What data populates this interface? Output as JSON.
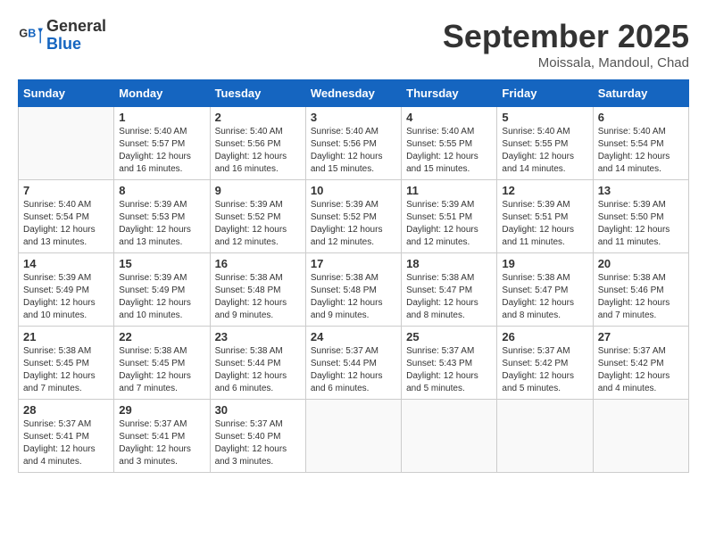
{
  "logo": {
    "line1": "General",
    "line2": "Blue"
  },
  "title": "September 2025",
  "subtitle": "Moissala, Mandoul, Chad",
  "days_of_week": [
    "Sunday",
    "Monday",
    "Tuesday",
    "Wednesday",
    "Thursday",
    "Friday",
    "Saturday"
  ],
  "weeks": [
    [
      {
        "day": "",
        "content": ""
      },
      {
        "day": "1",
        "content": "Sunrise: 5:40 AM\nSunset: 5:57 PM\nDaylight: 12 hours\nand 16 minutes."
      },
      {
        "day": "2",
        "content": "Sunrise: 5:40 AM\nSunset: 5:56 PM\nDaylight: 12 hours\nand 16 minutes."
      },
      {
        "day": "3",
        "content": "Sunrise: 5:40 AM\nSunset: 5:56 PM\nDaylight: 12 hours\nand 15 minutes."
      },
      {
        "day": "4",
        "content": "Sunrise: 5:40 AM\nSunset: 5:55 PM\nDaylight: 12 hours\nand 15 minutes."
      },
      {
        "day": "5",
        "content": "Sunrise: 5:40 AM\nSunset: 5:55 PM\nDaylight: 12 hours\nand 14 minutes."
      },
      {
        "day": "6",
        "content": "Sunrise: 5:40 AM\nSunset: 5:54 PM\nDaylight: 12 hours\nand 14 minutes."
      }
    ],
    [
      {
        "day": "7",
        "content": "Sunrise: 5:40 AM\nSunset: 5:54 PM\nDaylight: 12 hours\nand 13 minutes."
      },
      {
        "day": "8",
        "content": "Sunrise: 5:39 AM\nSunset: 5:53 PM\nDaylight: 12 hours\nand 13 minutes."
      },
      {
        "day": "9",
        "content": "Sunrise: 5:39 AM\nSunset: 5:52 PM\nDaylight: 12 hours\nand 12 minutes."
      },
      {
        "day": "10",
        "content": "Sunrise: 5:39 AM\nSunset: 5:52 PM\nDaylight: 12 hours\nand 12 minutes."
      },
      {
        "day": "11",
        "content": "Sunrise: 5:39 AM\nSunset: 5:51 PM\nDaylight: 12 hours\nand 12 minutes."
      },
      {
        "day": "12",
        "content": "Sunrise: 5:39 AM\nSunset: 5:51 PM\nDaylight: 12 hours\nand 11 minutes."
      },
      {
        "day": "13",
        "content": "Sunrise: 5:39 AM\nSunset: 5:50 PM\nDaylight: 12 hours\nand 11 minutes."
      }
    ],
    [
      {
        "day": "14",
        "content": "Sunrise: 5:39 AM\nSunset: 5:49 PM\nDaylight: 12 hours\nand 10 minutes."
      },
      {
        "day": "15",
        "content": "Sunrise: 5:39 AM\nSunset: 5:49 PM\nDaylight: 12 hours\nand 10 minutes."
      },
      {
        "day": "16",
        "content": "Sunrise: 5:38 AM\nSunset: 5:48 PM\nDaylight: 12 hours\nand 9 minutes."
      },
      {
        "day": "17",
        "content": "Sunrise: 5:38 AM\nSunset: 5:48 PM\nDaylight: 12 hours\nand 9 minutes."
      },
      {
        "day": "18",
        "content": "Sunrise: 5:38 AM\nSunset: 5:47 PM\nDaylight: 12 hours\nand 8 minutes."
      },
      {
        "day": "19",
        "content": "Sunrise: 5:38 AM\nSunset: 5:47 PM\nDaylight: 12 hours\nand 8 minutes."
      },
      {
        "day": "20",
        "content": "Sunrise: 5:38 AM\nSunset: 5:46 PM\nDaylight: 12 hours\nand 7 minutes."
      }
    ],
    [
      {
        "day": "21",
        "content": "Sunrise: 5:38 AM\nSunset: 5:45 PM\nDaylight: 12 hours\nand 7 minutes."
      },
      {
        "day": "22",
        "content": "Sunrise: 5:38 AM\nSunset: 5:45 PM\nDaylight: 12 hours\nand 7 minutes."
      },
      {
        "day": "23",
        "content": "Sunrise: 5:38 AM\nSunset: 5:44 PM\nDaylight: 12 hours\nand 6 minutes."
      },
      {
        "day": "24",
        "content": "Sunrise: 5:37 AM\nSunset: 5:44 PM\nDaylight: 12 hours\nand 6 minutes."
      },
      {
        "day": "25",
        "content": "Sunrise: 5:37 AM\nSunset: 5:43 PM\nDaylight: 12 hours\nand 5 minutes."
      },
      {
        "day": "26",
        "content": "Sunrise: 5:37 AM\nSunset: 5:42 PM\nDaylight: 12 hours\nand 5 minutes."
      },
      {
        "day": "27",
        "content": "Sunrise: 5:37 AM\nSunset: 5:42 PM\nDaylight: 12 hours\nand 4 minutes."
      }
    ],
    [
      {
        "day": "28",
        "content": "Sunrise: 5:37 AM\nSunset: 5:41 PM\nDaylight: 12 hours\nand 4 minutes."
      },
      {
        "day": "29",
        "content": "Sunrise: 5:37 AM\nSunset: 5:41 PM\nDaylight: 12 hours\nand 3 minutes."
      },
      {
        "day": "30",
        "content": "Sunrise: 5:37 AM\nSunset: 5:40 PM\nDaylight: 12 hours\nand 3 minutes."
      },
      {
        "day": "",
        "content": ""
      },
      {
        "day": "",
        "content": ""
      },
      {
        "day": "",
        "content": ""
      },
      {
        "day": "",
        "content": ""
      }
    ]
  ]
}
